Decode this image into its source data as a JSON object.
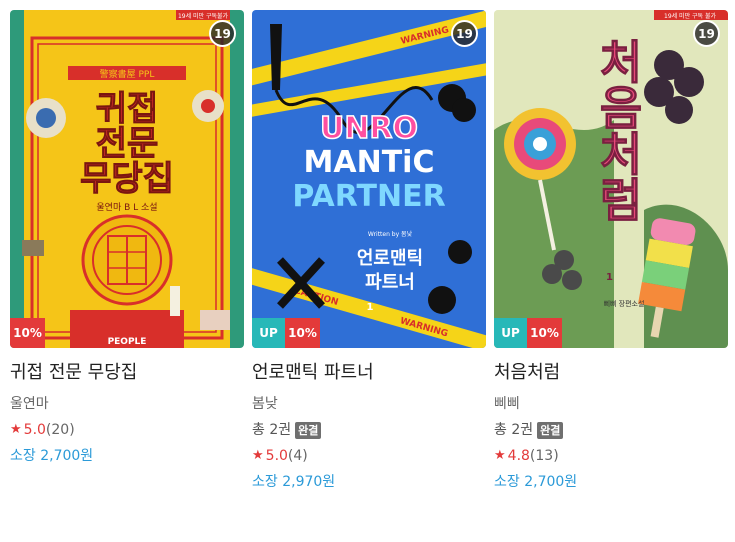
{
  "books": [
    {
      "title": "귀접 전문 무당집",
      "author": "울연마",
      "age": "19",
      "up": "",
      "discount": "10%",
      "volumes": "",
      "completed": "",
      "rating": "5.0",
      "rating_count": "(20)",
      "price": "소장 2,700원",
      "cover": {
        "bg": "#f5c518",
        "accent": "#d82f2a",
        "top_label": "19세 미만 구독불가",
        "series_label": "警察書屋 PPL",
        "line1": "귀접",
        "line2": "전문",
        "line3": "무당집",
        "sub": "울연마 B L 소설",
        "publisher": "PEOPLE",
        "icon": "ornate-door-cover-art"
      }
    },
    {
      "title": "언로맨틱 파트너",
      "author": "봄낮",
      "age": "19",
      "up": "UP",
      "discount": "10%",
      "volumes": "총 2권",
      "completed": "완결",
      "rating": "5.0",
      "rating_count": "(4)",
      "price": "소장 2,970원",
      "cover": {
        "bg": "#2f6fd6",
        "tape": "WARNING",
        "tape2": "CAUTION",
        "line1": "UNRO",
        "line2": "MANTiC",
        "line3": "PARTNER",
        "written_by": "Written by 봄낮",
        "kr1": "언로맨틱",
        "kr2": "파트너",
        "vol": "1",
        "icon": "whip-handcuffs-cover-art"
      }
    },
    {
      "title": "처음처럼",
      "author": "삐삐",
      "age": "19",
      "up": "UP",
      "discount": "10%",
      "volumes": "총 2권",
      "completed": "완결",
      "rating": "4.8",
      "rating_count": "(13)",
      "price": "소장 2,700원",
      "cover": {
        "bg": "#e8ead0",
        "top_label": "19세 미만 구독 불가",
        "title_text": "처음처럼",
        "vol": "1",
        "author_small": "삐삐 장편소설",
        "icon": "lollipop-grapes-cover-art"
      }
    }
  ]
}
